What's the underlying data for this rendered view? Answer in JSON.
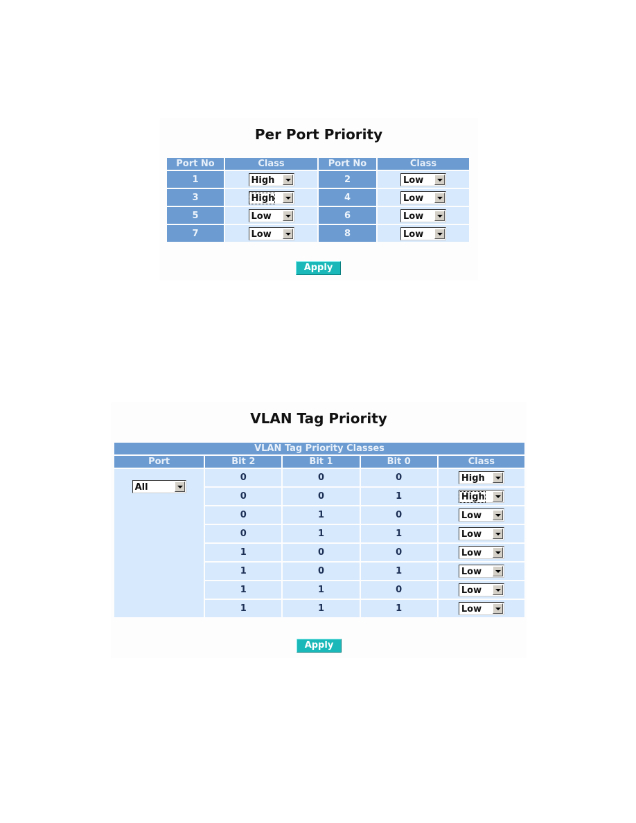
{
  "per_port": {
    "title": "Per Port Priority",
    "headers": [
      "Port No",
      "Class",
      "Port No",
      "Class"
    ],
    "rows": [
      {
        "a_port": "1",
        "a_class": "High",
        "b_port": "2",
        "b_class": "Low"
      },
      {
        "a_port": "3",
        "a_class": "High",
        "b_port": "4",
        "b_class": "Low"
      },
      {
        "a_port": "5",
        "a_class": "Low",
        "b_port": "6",
        "b_class": "Low"
      },
      {
        "a_port": "7",
        "a_class": "Low",
        "b_port": "8",
        "b_class": "Low"
      }
    ],
    "apply_label": "Apply"
  },
  "vlan": {
    "title": "VLAN Tag Priority",
    "caption": "VLAN Tag Priority Classes",
    "headers": [
      "Port",
      "Bit 2",
      "Bit 1",
      "Bit 0",
      "Class"
    ],
    "port_value": "All",
    "rows": [
      {
        "b2": "0",
        "b1": "0",
        "b0": "0",
        "cls": "High"
      },
      {
        "b2": "0",
        "b1": "0",
        "b0": "1",
        "cls": "High"
      },
      {
        "b2": "0",
        "b1": "1",
        "b0": "0",
        "cls": "Low"
      },
      {
        "b2": "0",
        "b1": "1",
        "b0": "1",
        "cls": "Low"
      },
      {
        "b2": "1",
        "b1": "0",
        "b0": "0",
        "cls": "Low"
      },
      {
        "b2": "1",
        "b1": "0",
        "b0": "1",
        "cls": "Low"
      },
      {
        "b2": "1",
        "b1": "1",
        "b0": "0",
        "cls": "Low"
      },
      {
        "b2": "1",
        "b1": "1",
        "b0": "1",
        "cls": "Low"
      }
    ],
    "apply_label": "Apply"
  },
  "colors": {
    "header": "#6b9bd0",
    "cell": "#d7e9fc",
    "button": "#1ab8b8"
  }
}
